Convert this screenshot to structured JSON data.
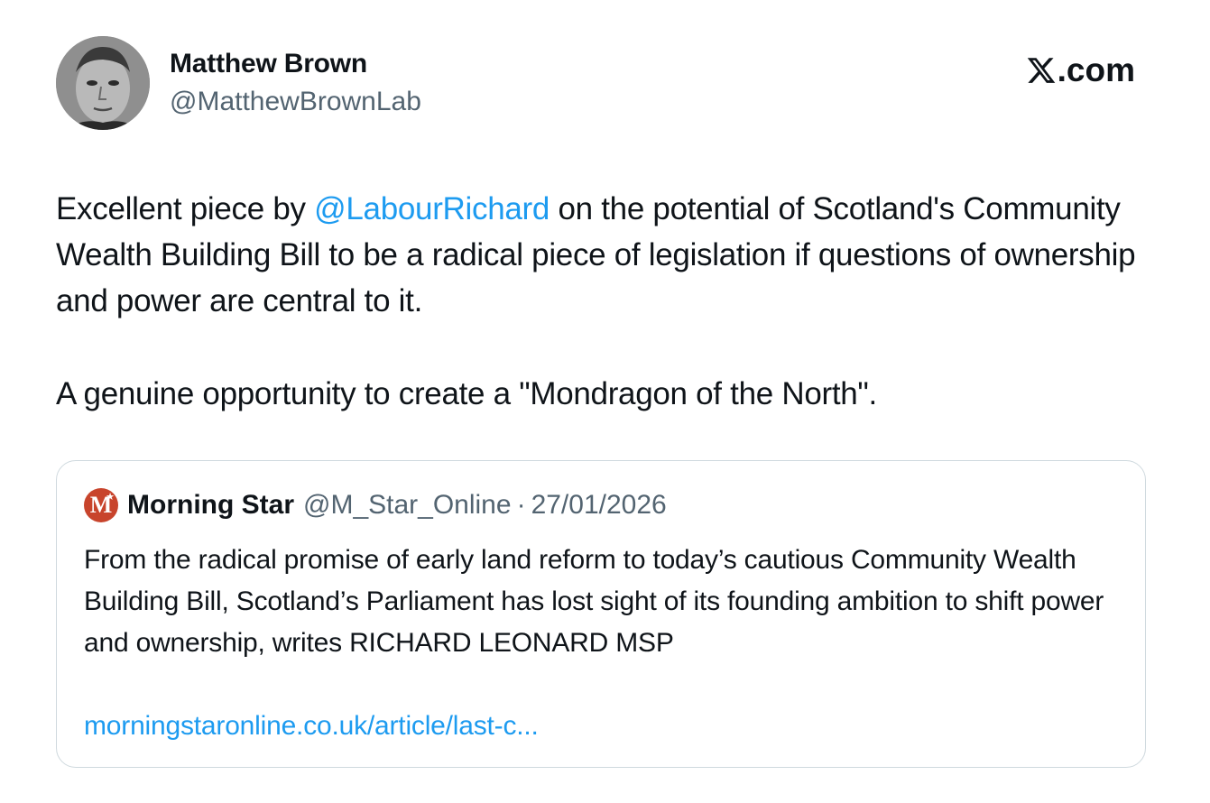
{
  "author": {
    "name": "Matthew Brown",
    "handle": "@MatthewBrownLab"
  },
  "brand": {
    "label": ".com",
    "icon": "x-logo-icon"
  },
  "tweet": {
    "paragraph1": {
      "before": "Excellent piece by ",
      "mention": "@LabourRichard",
      "after": " on the potential of Scotland's Community Wealth Building Bill to be a radical piece of legislation if questions of ownership and power are central to it."
    },
    "paragraph2": "A genuine opportunity to create a  \"Mondragon of the North\"."
  },
  "quote": {
    "logo_letter": "M",
    "name": "Morning Star",
    "handle": "@M_Star_Online",
    "separator": "·",
    "date": "27/01/2026",
    "text": "From the radical promise of early land reform to today’s cautious Community Wealth Building Bill, Scotland’s Parliament has lost sight of its founding ambition to shift power and ownership, writes RICHARD LEONARD MSP",
    "link": "morningstaronline.co.uk/article/last-c..."
  },
  "colors": {
    "text": "#0f1419",
    "secondary": "#536471",
    "link": "#1d9bf0",
    "border": "#cfd9de",
    "quote_logo_bg": "#c8442c"
  }
}
